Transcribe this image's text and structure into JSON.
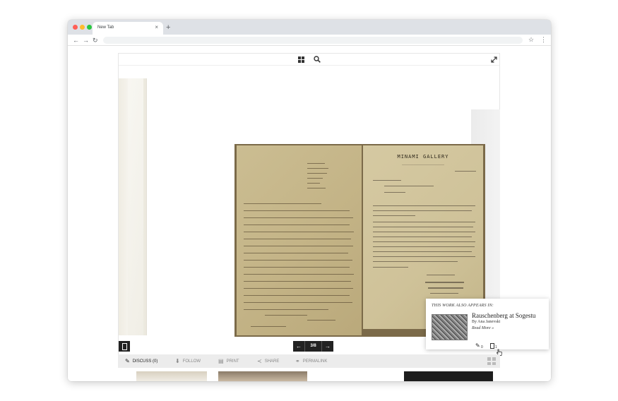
{
  "browser": {
    "tab_title": "New Tab",
    "tab_close": "×",
    "new_tab": "+",
    "back": "←",
    "forward": "→",
    "reload": "↻",
    "url": "",
    "bookmark": "☆",
    "menu": "⋮"
  },
  "viewer": {
    "pager": {
      "prev": "←",
      "count": "3/8",
      "next": "→"
    },
    "artwork_letterhead": "MINAMI GALLERY",
    "annotations_count": "0",
    "appears_in_count": "1"
  },
  "appears_in": {
    "heading": "THIS WORK ALSO APPEARS IN:",
    "title": "Rauschenberg at Sogestu",
    "author": "By Ana Janevski",
    "read_more": "Read More »"
  },
  "actions": {
    "discuss": "DISCUSS (0)",
    "follow": "FOLLOW",
    "print": "PRINT",
    "share": "SHARE",
    "permalink": "PERMALINK"
  },
  "icons": {
    "grid": "grid-icon",
    "search": "search-icon",
    "expand": "expand-icon",
    "pencil": "pencil-icon",
    "book": "book-icon",
    "tiles": "tiles-icon"
  }
}
